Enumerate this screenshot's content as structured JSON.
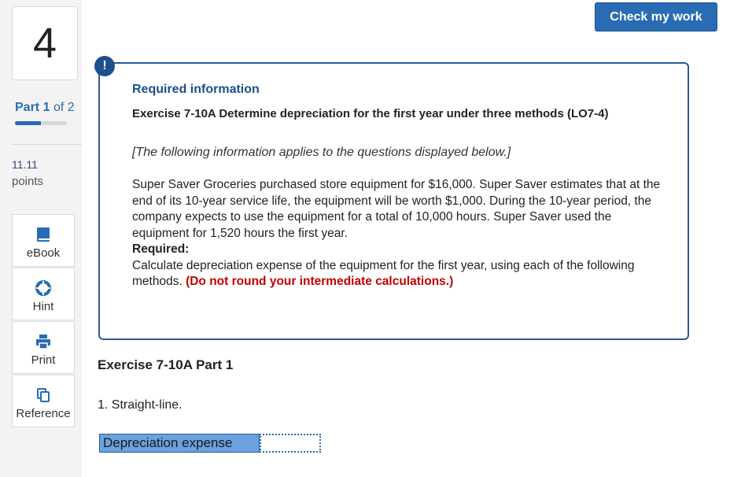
{
  "header": {
    "check_button": "Check my work"
  },
  "sidebar": {
    "question_number": "4",
    "part": {
      "word": "Part",
      "current": "1",
      "of_text": "of 2",
      "progress_fraction": 0.5
    },
    "points_value": "11.11",
    "points_label": "points",
    "tools": [
      {
        "label": "eBook",
        "icon": "book-icon"
      },
      {
        "label": "Hint",
        "icon": "lifebuoy-icon"
      },
      {
        "label": "Print",
        "icon": "printer-icon"
      },
      {
        "label": "Reference",
        "icon": "copy-icon"
      }
    ]
  },
  "info": {
    "badge": "!",
    "heading": "Required information",
    "exercise_title": "Exercise 7-10A Determine depreciation for the first year under three methods (LO7-4)",
    "note": "[The following information applies to the questions displayed below.]",
    "paragraph": "Super Saver Groceries purchased store equipment for $16,000. Super Saver estimates that at the end of its 10-year service life, the equipment will be worth $1,000. During the 10-year period, the company expects to use the equipment for a total of 10,000 hours. Super Saver used the equipment for 1,520 hours the first year.",
    "required_label": "Required:",
    "instruction": "Calculate depreciation expense of the equipment for the first year, using each of the following methods.",
    "instruction_note": "(Do not round your intermediate calculations.)"
  },
  "part_section": {
    "heading": "Exercise 7-10A Part 1",
    "question": "1. Straight-line.",
    "row_label": "Depreciation expense",
    "input_value": ""
  },
  "colors": {
    "accent": "#2a6cb3",
    "alert_red": "#c00000",
    "label_fill": "#6aa1de"
  }
}
